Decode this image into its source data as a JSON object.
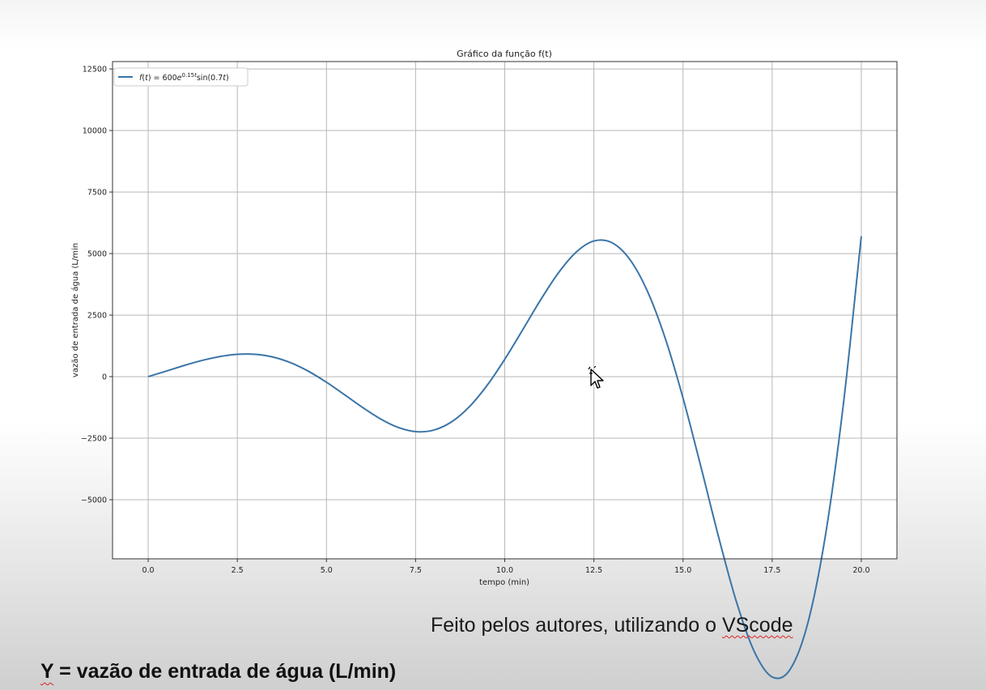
{
  "chart_data": {
    "type": "line",
    "title": "Gráfico da função f(t)",
    "xlabel": "tempo (min)",
    "ylabel": "vazão de entrada de água (L/min",
    "xlim": [
      -1.0,
      21.0
    ],
    "ylim": [
      -7400,
      12800
    ],
    "xticks": [
      "0.0",
      "2.5",
      "5.0",
      "7.5",
      "10.0",
      "12.5",
      "15.0",
      "17.5",
      "20.0"
    ],
    "yticks": [
      "12500",
      "10000",
      "7500",
      "5000",
      "2500",
      "0",
      "−2500",
      "−5000"
    ],
    "grid": true,
    "legend_position": "top-left",
    "series": [
      {
        "name": "f(t) = 600e^(0.15t)sin(0.7t)",
        "color": "#3a75a8",
        "x": [
          0,
          0.5,
          1,
          1.5,
          2,
          2.5,
          3,
          3.5,
          4,
          4.5,
          5,
          5.5,
          6,
          6.5,
          7,
          7.5,
          8,
          8.5,
          9,
          9.5,
          10,
          10.5,
          11,
          11.5,
          12,
          12.5,
          13,
          13.5,
          14,
          14.5,
          15,
          15.5,
          16,
          16.5,
          17,
          17.5,
          18,
          18.5,
          19,
          19.5,
          20
        ],
        "y": [
          0,
          222,
          450,
          654,
          813,
          905,
          907,
          797,
          563,
          214,
          -227,
          -726,
          -1237,
          -1703,
          -2057,
          -2233,
          -2175,
          -1845,
          -1234,
          -364,
          704,
          1895,
          3105,
          4206,
          5054,
          5510,
          5447,
          4779,
          3475,
          1563,
          -870,
          -3651,
          -6524,
          -9155,
          -11172,
          -12200,
          -11901,
          -10012,
          -6397,
          -1088,
          5702
        ]
      }
    ]
  },
  "caption": {
    "before": "Feito pelos autores, utilizando o ",
    "highlight": "VScode"
  },
  "footer": {
    "symbol": "Y",
    "definition": " = vazão de entrada de água (L/min)"
  }
}
